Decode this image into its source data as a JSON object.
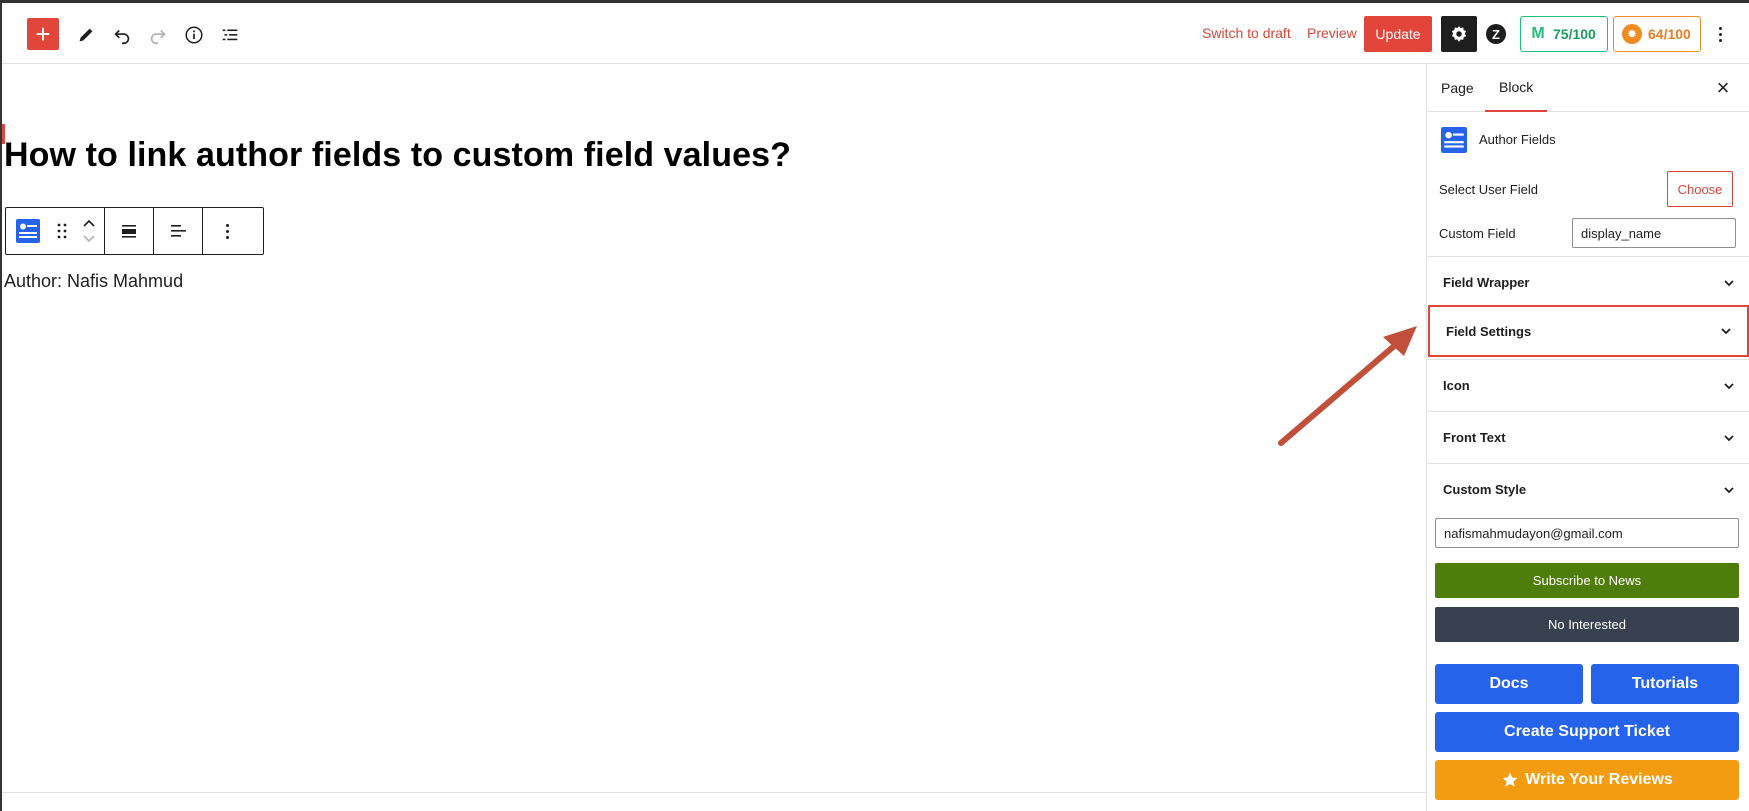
{
  "toolbar": {
    "add_icon": "plus-icon",
    "add_label": "+",
    "switch_to_draft": "Switch to draft",
    "preview": "Preview",
    "update": "Update",
    "score_seo": "75/100",
    "score_readability": "64/100"
  },
  "post": {
    "title": "How to link author fields to custom field values?",
    "author_line": "Author: Nafis Mahmud"
  },
  "sidebar": {
    "tabs": [
      {
        "label": "Page"
      },
      {
        "label": "Block"
      }
    ],
    "active_tab": "Block",
    "block_name": "Author Fields",
    "select_user_field_label": "Select User Field",
    "choose_label": "Choose",
    "custom_field_label": "Custom Field",
    "custom_field_value": "display_name",
    "panels": [
      {
        "label": "Field Wrapper"
      },
      {
        "label": "Field Settings"
      },
      {
        "label": "Icon"
      },
      {
        "label": "Front Text"
      },
      {
        "label": "Custom Style"
      }
    ],
    "email_value": "nafismahmudayon@gmail.com",
    "subscribe_label": "Subscribe to News",
    "no_interested_label": "No Interested",
    "docs_label": "Docs",
    "tutorials_label": "Tutorials",
    "support_label": "Create Support Ticket",
    "review_label": "Write Your Reviews"
  },
  "colors": {
    "accent": "#e2463a",
    "subscribe": "#4e7d0b",
    "dark_button": "#394150",
    "blue_button": "#2563eb",
    "review_button": "#f39c12",
    "annotation_arrow": "#c0503a"
  }
}
